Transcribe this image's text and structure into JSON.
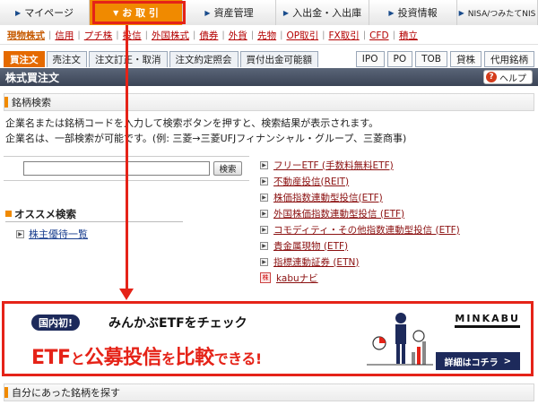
{
  "nav": {
    "tabs": [
      {
        "label": "マイページ",
        "active": false,
        "w": 100
      },
      {
        "label": "お 取 引",
        "active": true,
        "w": 104
      },
      {
        "label": "資産管理",
        "active": false,
        "w": 104
      },
      {
        "label": "入出金・入出庫",
        "active": false,
        "w": 104
      },
      {
        "label": "投資情報",
        "active": false,
        "w": 98
      },
      {
        "label": "NISA/つみたてNIS",
        "active": false,
        "w": 90
      }
    ]
  },
  "subnav": {
    "links": [
      "現物株式",
      "信用",
      "プチ株",
      "投信",
      "外国株式",
      "債券",
      "外貨",
      "先物",
      "OP取引",
      "FX取引",
      "CFD",
      "積立"
    ]
  },
  "ordertabs": {
    "left": [
      "買注文",
      "売注文",
      "注文訂正・取消",
      "注文約定照会",
      "買付出金可能額"
    ],
    "right": [
      "IPO",
      "PO",
      "TOB",
      "貸株",
      "代用銘柄"
    ]
  },
  "title": {
    "text": "株式買注文",
    "help": "ヘルプ"
  },
  "search_section": {
    "heading": "銘柄検索",
    "line1": "企業名または銘柄コードを入力して検索ボタンを押すと、検索結果が表示されます。",
    "line2": "企業名は、一部検索が可能です。(例: 三菱→三菱UFJフィナンシャル・グループ、三菱商事)",
    "input_value": "",
    "button": "検索"
  },
  "recommend": {
    "heading": "オススメ検索",
    "link": "株主優待一覧"
  },
  "right_links": [
    "フリーETF (手数料無料ETF)",
    "不動産投信(REIT)",
    "株価指数連動型投信(ETF)",
    "外国株価指数連動型投信 (ETF)",
    "コモディティ・その他指数連動型投信 (ETF)",
    "貴金属現物 (ETF)",
    "指標連動証券 (ETN)"
  ],
  "kabu_link": "kabuナビ",
  "banner": {
    "badge": "国内初!",
    "sub": "みんかぶETFをチェック",
    "main_a": "ETF",
    "main_b": "と",
    "main_c": "公募投信",
    "main_d": "を",
    "main_e": "比較",
    "main_f": "できる!",
    "logo": "MINKABU",
    "more": "詳細はコチラ",
    "more_arrow": ">"
  },
  "bottom_section": {
    "heading": "自分にあった銘柄を探す"
  },
  "colors": {
    "accent": "#f08a00",
    "highlight": "#e52318",
    "navy": "#1d2a5b",
    "link": "#8b1010"
  }
}
